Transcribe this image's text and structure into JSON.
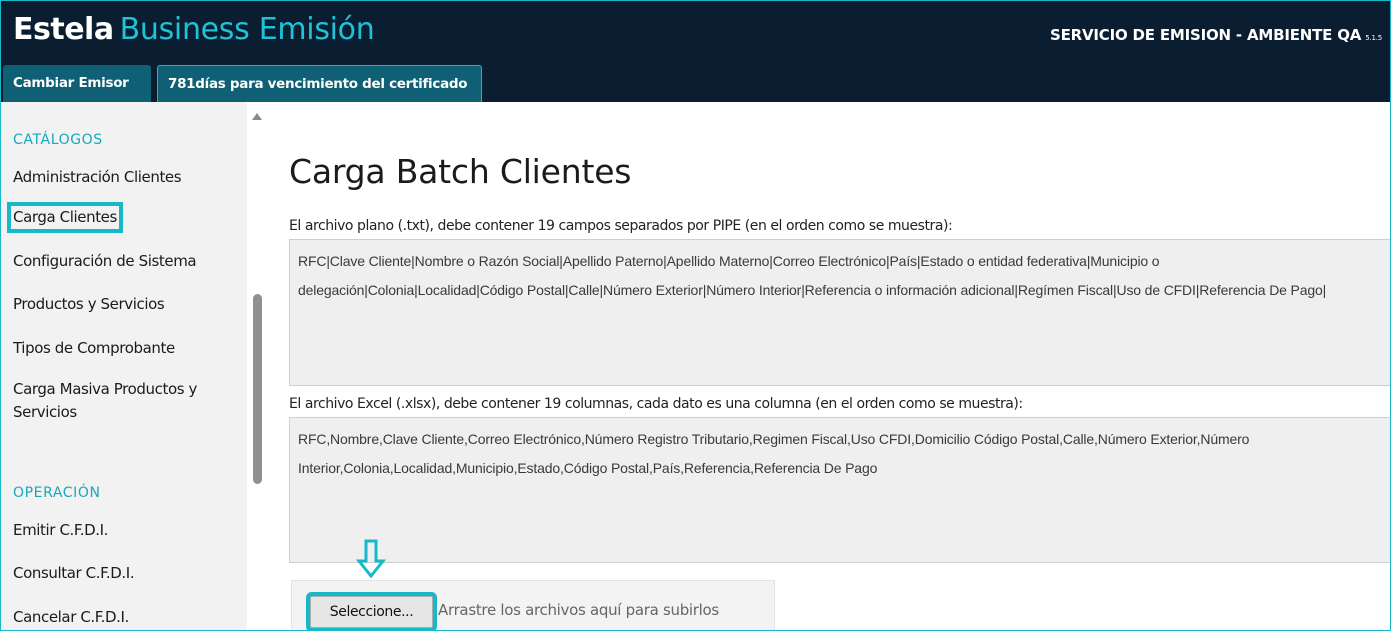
{
  "header": {
    "brand_strong": "Estela",
    "brand_light": "Business Emisión",
    "service": "SERVICIO DE EMISION - AMBIENTE QA",
    "version": "5.1.5"
  },
  "tabs": [
    {
      "label": "Cambiar Emisor"
    },
    {
      "label": "781días para vencimiento del certificado"
    }
  ],
  "sidebar": {
    "catalogos_title": "CATÁLOGOS",
    "catalogos_items": [
      {
        "label": "Administración Clientes"
      },
      {
        "label": "Carga Clientes"
      },
      {
        "label": "Configuración de Sistema"
      },
      {
        "label": "Productos y Servicios"
      },
      {
        "label": "Tipos de Comprobante"
      },
      {
        "label": "Carga Masiva Productos y Servicios"
      }
    ],
    "operacion_title": "OPERACIÓN",
    "operacion_items": [
      {
        "label": "Emitir C.F.D.I."
      },
      {
        "label": "Consultar C.F.D.I."
      },
      {
        "label": "Cancelar C.F.D.I."
      }
    ]
  },
  "main": {
    "title": "Carga Batch Clientes",
    "txt_hint": "El archivo plano (.txt), debe contener 19 campos separados por PIPE (en el orden como se muestra):",
    "txt_format": "RFC|Clave Cliente|Nombre o Razón Social|Apellido Paterno|Apellido Materno|Correo Electrónico|País|Estado o entidad federativa|Municipio o delegación|Colonia|Localidad|Código Postal|Calle|Número Exterior|Número Interior|Referencia o información adicional|Regímen Fiscal|Uso de CFDI|Referencia De Pago|",
    "xlsx_hint": "El archivo Excel (.xlsx), debe contener 19 columnas, cada dato es una columna (en el orden como se muestra):",
    "xlsx_format": "RFC,Nombre,Clave Cliente,Correo Electrónico,Número Registro Tributario,Regimen Fiscal,Uso CFDI,Domicilio Código Postal,Calle,Número Exterior,Número Interior,Colonia,Localidad,Municipio,Estado,Código Postal,País,Referencia,Referencia De Pago",
    "upload_button": "Seleccione...",
    "drop_text": "Arrastre los archivos aquí para subirlos"
  },
  "colors": {
    "header_bg": "#0b1d30",
    "accent": "#19b8c9",
    "tab_bg": "#0f5f75"
  },
  "icons": {
    "annotation": "arrow-down-icon"
  }
}
